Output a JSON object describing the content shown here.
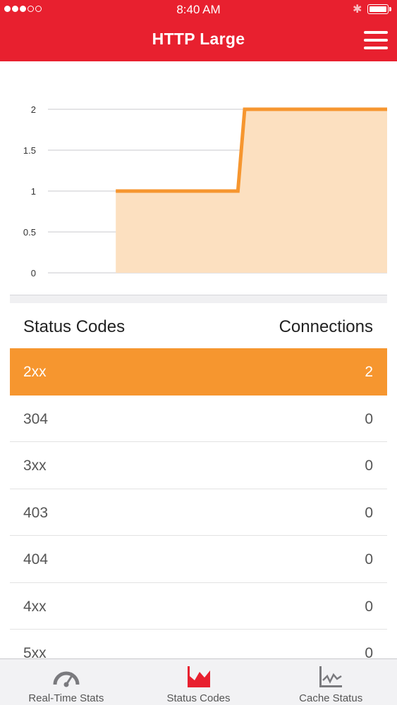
{
  "status_bar": {
    "time": "8:40 AM",
    "bluetooth": "bluetooth-icon",
    "battery": "battery-icon"
  },
  "header": {
    "title": "HTTP Large",
    "menu_icon": "hamburger-menu-icon",
    "background": "#e8202f"
  },
  "chart_data": {
    "type": "area",
    "y_ticks": [
      "0",
      "0.5",
      "1",
      "1.5",
      "2"
    ],
    "ylim": [
      0,
      2
    ],
    "grid": true,
    "color": "#f6962f",
    "fill": "#fce0c0",
    "series": [
      {
        "points": [
          [
            0.2,
            1
          ],
          [
            0.56,
            1
          ],
          [
            0.58,
            2
          ],
          [
            1.0,
            2
          ]
        ]
      }
    ],
    "xlim": [
      0,
      1
    ]
  },
  "table": {
    "headers": {
      "left": "Status Codes",
      "right": "Connections"
    },
    "rows": [
      {
        "code": "2xx",
        "count": "2",
        "active": true
      },
      {
        "code": "304",
        "count": "0"
      },
      {
        "code": "3xx",
        "count": "0"
      },
      {
        "code": "403",
        "count": "0"
      },
      {
        "code": "404",
        "count": "0"
      },
      {
        "code": "4xx",
        "count": "0"
      },
      {
        "code": "5xx",
        "count": "0"
      }
    ],
    "active_color": "#f6962f"
  },
  "tabs": [
    {
      "label": "Real-Time Stats",
      "icon": "gauge-icon",
      "active": false
    },
    {
      "label": "Status Codes",
      "icon": "area-chart-icon",
      "active": true
    },
    {
      "label": "Cache Status",
      "icon": "line-chart-icon",
      "active": false
    }
  ]
}
